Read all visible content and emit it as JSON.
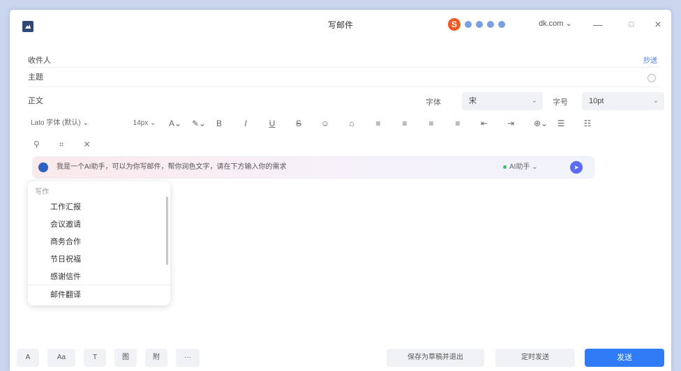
{
  "window": {
    "title": "写邮件",
    "sender": "dk.com",
    "minimize": "—",
    "maximize": "□",
    "close": "✕"
  },
  "header": {
    "to_label": "收件人",
    "subject_label": "主题",
    "cc_link": "抄送",
    "body_label": "正文"
  },
  "format": {
    "font_label": "字体",
    "font_value": "宋",
    "size_label": "字号",
    "size_value": "10pt"
  },
  "toolbar": {
    "font_family": "Lato 字体 (默认)",
    "font_size": "14px",
    "more_label": "···"
  },
  "ai_bar": {
    "prompt": "我是一个AI助手，可以为你写邮件，帮你润色文字，请在下方输入你的需求",
    "model": "AI助手",
    "send_label": "➤"
  },
  "dropdown": {
    "header": "写作",
    "items": [
      "工作汇报",
      "会议邀请",
      "商务合作",
      "节日祝福",
      "感谢信件"
    ],
    "footer": "邮件翻译"
  },
  "bottom": {
    "b1": "A",
    "b2": "Aa",
    "b3": "T",
    "b4": "图",
    "b5": "附",
    "b6": "···",
    "save_draft": "保存为草稿并退出",
    "schedule": "定时发送",
    "send": "发送"
  },
  "colors": {
    "accent": "#2f7cf6",
    "ai_send": "#5b6cf2",
    "background": "#c9d6ee"
  }
}
